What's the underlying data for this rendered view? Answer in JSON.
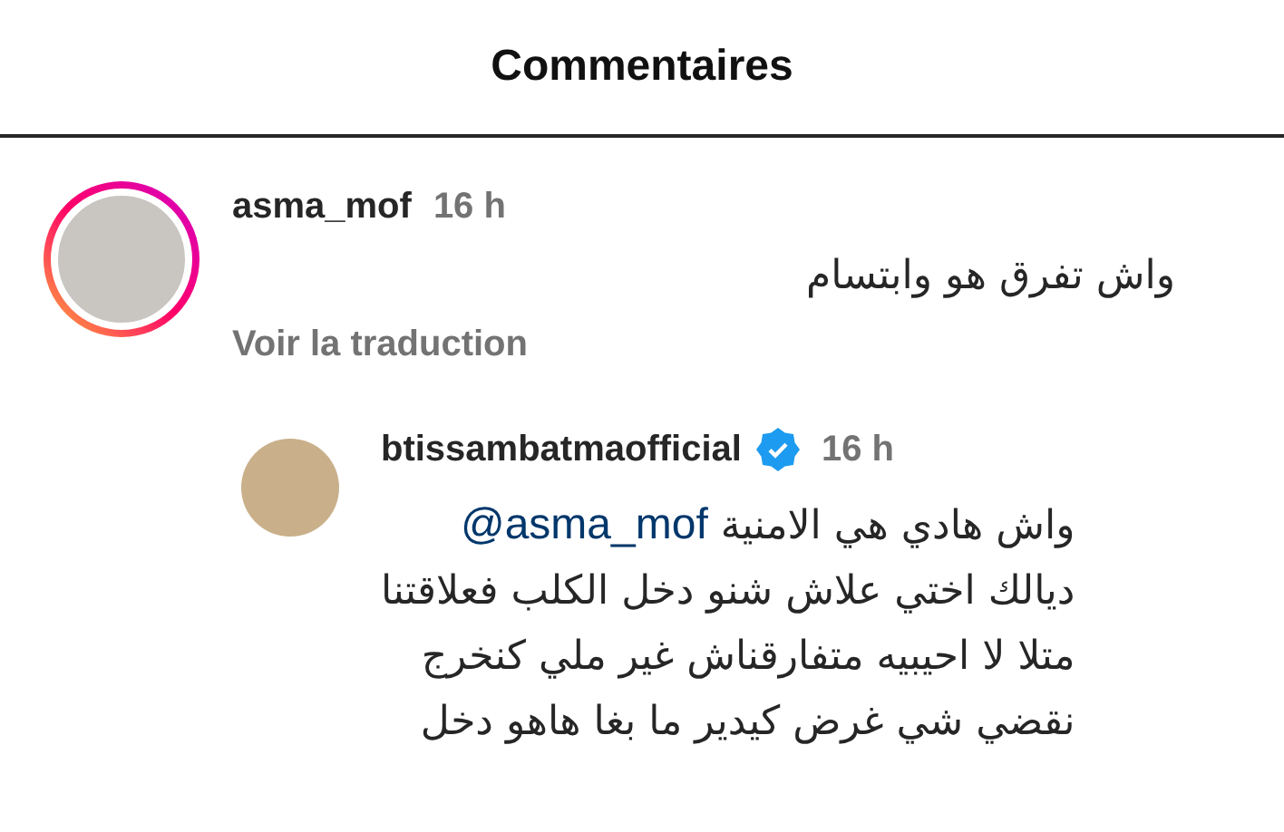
{
  "header": {
    "title": "Commentaires"
  },
  "comment": {
    "username": "asma_mof",
    "time": "16 h",
    "has_story": true,
    "text": "واش تفرق هو وابتسام",
    "translate_link": "Voir la traduction"
  },
  "reply": {
    "username": "btissambatmaofficial",
    "verified": true,
    "time": "16 h",
    "mention": "@asma_mof",
    "lines": [
      "واش هادي هي الامنية",
      "ديالك اختي علاش شنو دخل الكلب فعلاقتنا",
      "متلا لا احيبيه متفارقناش غير ملي كنخرج",
      "نقضي شي غرض كيدير ما بغا هاهو دخل"
    ]
  }
}
